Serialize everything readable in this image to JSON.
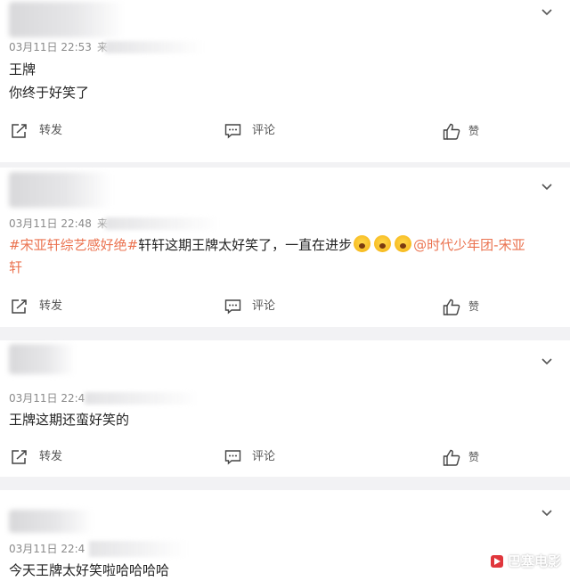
{
  "colors": {
    "topic": "#eb7350",
    "card_bg": "#ffffff",
    "page_bg": "#f2f2f4"
  },
  "actions": {
    "forward_label": "转发",
    "comment_label": "评论",
    "like_label": "赞"
  },
  "comments": [
    {
      "time": "03月11日 22:53",
      "source": "来",
      "lines": [
        "王牌",
        "你终于好笑了"
      ]
    },
    {
      "time": "03月11日 22:48",
      "source": "来",
      "line1": {
        "topic": "#宋亚轩综艺感好绝#",
        "text": "轩轩这期王牌太好笑了，一直在进步",
        "emojis": [
          "scream-emoji",
          "scream-emoji",
          "scream-emoji"
        ],
        "mention": "@时代少年团-宋亚"
      },
      "line2_mention": "轩"
    },
    {
      "time": "03月11日 22:4",
      "source": "",
      "lines": [
        "王牌这期还蛮好笑的"
      ]
    },
    {
      "time": "03月11日 22:4",
      "source": "",
      "lines": [
        "今天王牌太好笑啦哈哈哈哈"
      ]
    }
  ],
  "watermark": "巴塞电影"
}
